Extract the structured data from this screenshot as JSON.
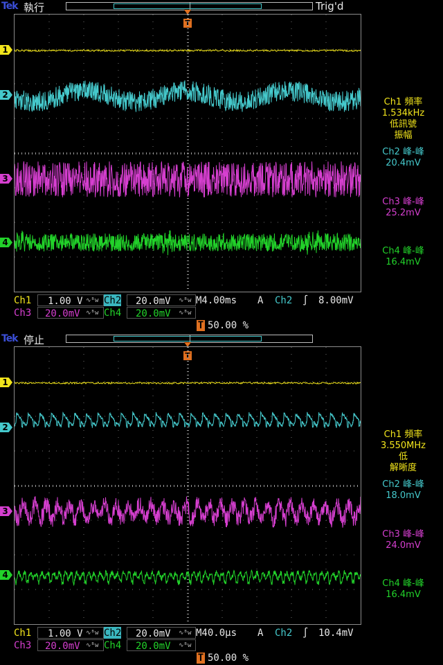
{
  "colors": {
    "ch1": "#f2e51c",
    "ch2": "#45c9cc",
    "ch3": "#d63fd0",
    "ch4": "#22d22a",
    "trigger": "#e07020",
    "brand": "#3b4fd8",
    "grid": "#6f6f6f"
  },
  "screens": [
    {
      "brand": "Tek",
      "run_state": "執行",
      "trig_state": "Trig'd",
      "trigger_marker": "T",
      "channel_markers": [
        "1",
        "2",
        "3",
        "4"
      ],
      "measurements": [
        {
          "lines": [
            "Ch1 頻率",
            "1.534kHz",
            "低訊號",
            "振幅"
          ],
          "color": "ch1"
        },
        {
          "lines": [
            "Ch2 峰-峰",
            "20.4mV"
          ],
          "color": "ch2"
        },
        {
          "lines": [
            "Ch3 峰-峰",
            "25.2mV"
          ],
          "color": "ch3"
        },
        {
          "lines": [
            "Ch4 峰-峰",
            "16.4mV"
          ],
          "color": "ch4"
        }
      ],
      "status": {
        "ch1_label": "Ch1",
        "ch1_scale": "1.00 V",
        "ch2_label": "Ch2",
        "ch2_scale": "20.0mV",
        "timebase": "M4.00ms",
        "trig_mode": "A",
        "trig_source": "Ch2",
        "trig_slope": "∫",
        "trig_level": "8.00mV",
        "ch3_label": "Ch3",
        "ch3_scale": "20.0mV",
        "ch4_label": "Ch4",
        "ch4_scale": "20.0mV",
        "trig_position": "50.00 %",
        "coupling_icon": "∿ᴮw"
      },
      "waveforms": {
        "ch2_style": "slow",
        "ch3_style": "noise",
        "ch4_style": "noise"
      }
    },
    {
      "brand": "Tek",
      "run_state": "停止",
      "trig_state": "",
      "trigger_marker": "T",
      "channel_markers": [
        "1",
        "2",
        "3",
        "4"
      ],
      "measurements": [
        {
          "lines": [
            "Ch1 頻率",
            "3.550MHz",
            "低",
            "解晰度"
          ],
          "color": "ch1"
        },
        {
          "lines": [
            "Ch2 峰-峰",
            "18.0mV"
          ],
          "color": "ch2"
        },
        {
          "lines": [
            "Ch3 峰-峰",
            "24.0mV"
          ],
          "color": "ch3"
        },
        {
          "lines": [
            "Ch4 峰-峰",
            "16.4mV"
          ],
          "color": "ch4"
        }
      ],
      "status": {
        "ch1_label": "Ch1",
        "ch1_scale": "1.00 V",
        "ch2_label": "Ch2",
        "ch2_scale": "20.0mV",
        "timebase": "M40.0µs",
        "trig_mode": "A",
        "trig_source": "Ch2",
        "trig_slope": "∫",
        "trig_level": "10.4mV",
        "ch3_label": "Ch3",
        "ch3_scale": "20.0mV",
        "ch4_label": "Ch4",
        "ch4_scale": "20.0mV",
        "trig_position": "50.00 %",
        "coupling_icon": "∿ᴮw"
      },
      "waveforms": {
        "ch2_style": "saw",
        "ch3_style": "spiky",
        "ch4_style": "ripple"
      }
    }
  ]
}
